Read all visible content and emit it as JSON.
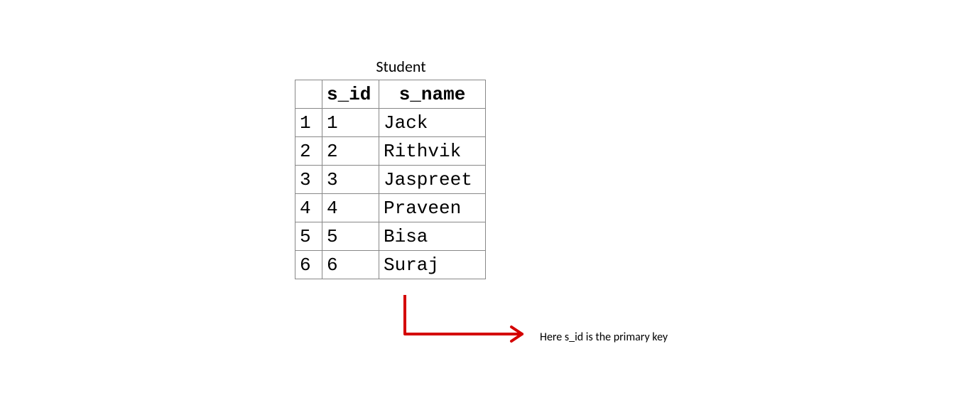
{
  "title": "Student",
  "columns": [
    "s_id",
    "s_name"
  ],
  "rows": [
    {
      "n": "1",
      "s_id": "1",
      "s_name": "Jack"
    },
    {
      "n": "2",
      "s_id": "2",
      "s_name": "Rithvik"
    },
    {
      "n": "3",
      "s_id": "3",
      "s_name": "Jaspreet"
    },
    {
      "n": "4",
      "s_id": "4",
      "s_name": "Praveen"
    },
    {
      "n": "5",
      "s_id": "5",
      "s_name": "Bisa"
    },
    {
      "n": "6",
      "s_id": "6",
      "s_name": "Suraj"
    }
  ],
  "annotation": "Here s_id  is the primary key",
  "arrow_color": "#d40000"
}
